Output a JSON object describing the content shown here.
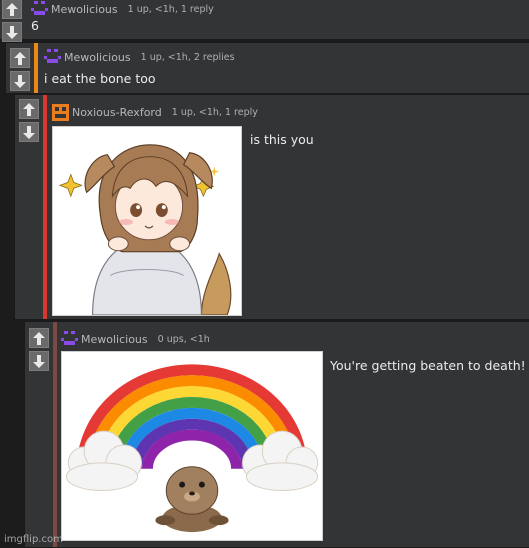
{
  "colors": {
    "panel": "#333436",
    "page": "#1c1c1c",
    "bar_level2": "#e8891a",
    "bar_level3": "#d63a2f",
    "bar_level4": "#7c4a44",
    "avatar_purple": "#8a4ce8",
    "avatar_orange": "#ea7d1e"
  },
  "comments": [
    {
      "username": "Mewolicious",
      "meta": "1 up, <1h, 1 reply",
      "text": "6",
      "avatar_icon": "purple-pixel-face-icon"
    },
    {
      "username": "Mewolicious",
      "meta": "1 up, <1h, 2 replies",
      "text": "i eat the bone too",
      "avatar_icon": "purple-pixel-face-icon"
    },
    {
      "username": "Noxious-Rexford",
      "meta": "1 up, <1h, 1 reply",
      "text": "is this you",
      "avatar_icon": "orange-pixel-face-icon",
      "image_icon": "anime-dog-girl-image"
    },
    {
      "username": "Mewolicious",
      "meta": "0 ups, <1h",
      "text": "You're getting beaten to death!",
      "avatar_icon": "purple-pixel-face-icon",
      "image_icon": "rainbow-seal-image"
    }
  ],
  "watermark": "imgflip.com"
}
